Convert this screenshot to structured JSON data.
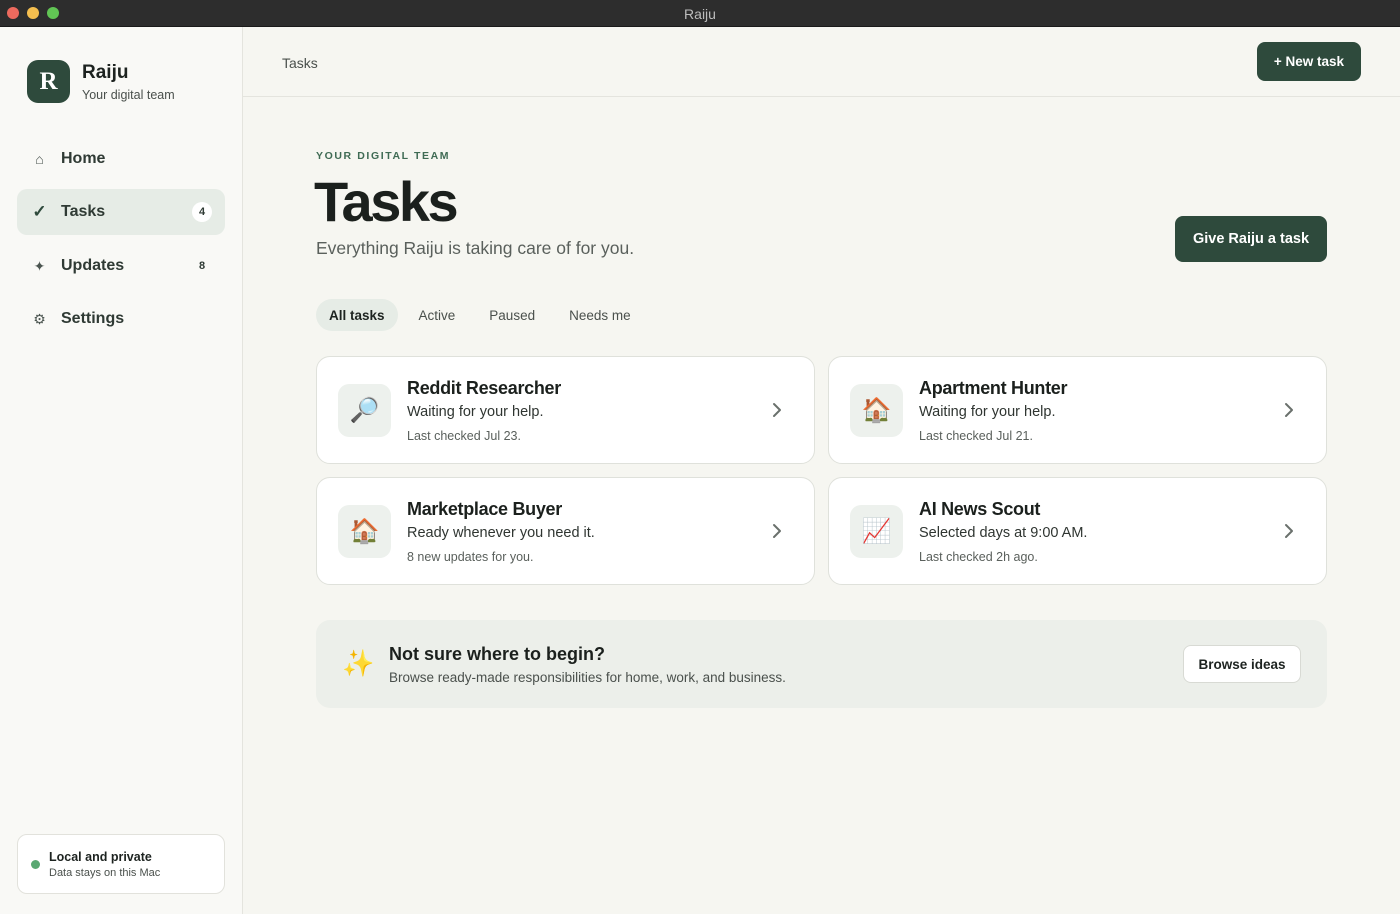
{
  "window": {
    "title": "Raiju"
  },
  "brand": {
    "logo_letter": "R",
    "name": "Raiju",
    "tagline": "Your digital team"
  },
  "sidebar": {
    "items": [
      {
        "label": "Home",
        "icon": "home-icon",
        "glyph": "⌂",
        "badge": "",
        "active": false
      },
      {
        "label": "Tasks",
        "icon": "check-icon",
        "glyph": "✓",
        "badge": "4",
        "active": true
      },
      {
        "label": "Updates",
        "icon": "sparkle-icon",
        "glyph": "✦",
        "badge": "8",
        "active": false
      },
      {
        "label": "Settings",
        "icon": "gear-icon",
        "glyph": "⚙",
        "badge": "",
        "active": false
      }
    ],
    "privacy": {
      "title": "Local and private",
      "subtitle": "Data stays on this Mac",
      "status_color": "#5aa872"
    }
  },
  "topbar": {
    "breadcrumb": "Tasks",
    "new_task_label": "+ New task"
  },
  "main": {
    "eyebrow": "YOUR DIGITAL TEAM",
    "title": "Tasks",
    "subtitle": "Everything Raiju is taking care of for you.",
    "give_task_label": "Give Raiju a task",
    "filters": [
      "All tasks",
      "Active",
      "Paused",
      "Needs me"
    ],
    "active_filter": "All tasks",
    "cards": [
      {
        "title": "Reddit Researcher",
        "status": "Waiting for your help.",
        "meta": "Last checked Jul 23.",
        "icon": "magnifier-icon",
        "glyph": "🔎"
      },
      {
        "title": "Apartment Hunter",
        "status": "Waiting for your help.",
        "meta": "Last checked Jul 21.",
        "icon": "house-icon",
        "glyph": "🏠"
      },
      {
        "title": "Marketplace Buyer",
        "status": "Ready whenever you need it.",
        "meta": "8 new updates for you.",
        "icon": "house-icon",
        "glyph": "🏠"
      },
      {
        "title": "AI News Scout",
        "status": "Selected days at 9:00 AM.",
        "meta": "Last checked 2h ago.",
        "icon": "chart-icon",
        "glyph": "📈"
      }
    ],
    "ideas": {
      "title": "Not sure where to begin?",
      "subtitle": "Browse ready-made responsibilities for home, work, and business.",
      "button_label": "Browse ideas",
      "icon": "sparkles-icon",
      "glyph": "✨"
    }
  },
  "colors": {
    "accent": "#2e4a3c",
    "eyebrow": "#3f6b54",
    "background": "#f6f6f1",
    "sidebar_bg": "#f9f9f6",
    "active_nav_bg": "#e6ece6"
  }
}
